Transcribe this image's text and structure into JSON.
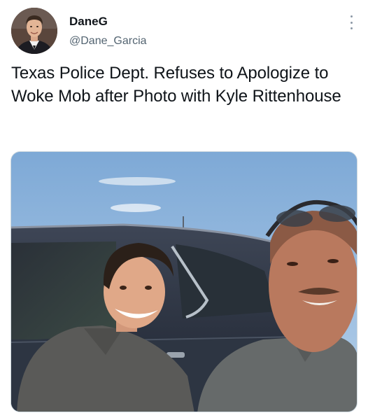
{
  "tweet": {
    "author": {
      "display_name": "DaneG",
      "handle": "@Dane_Garcia"
    },
    "text": "Texas Police Dept. Refuses to Apologize to Woke Mob after Photo with Kyle Rittenhouse",
    "menu_icon": "more-vertical-icon",
    "media": {
      "type": "photo"
    }
  }
}
